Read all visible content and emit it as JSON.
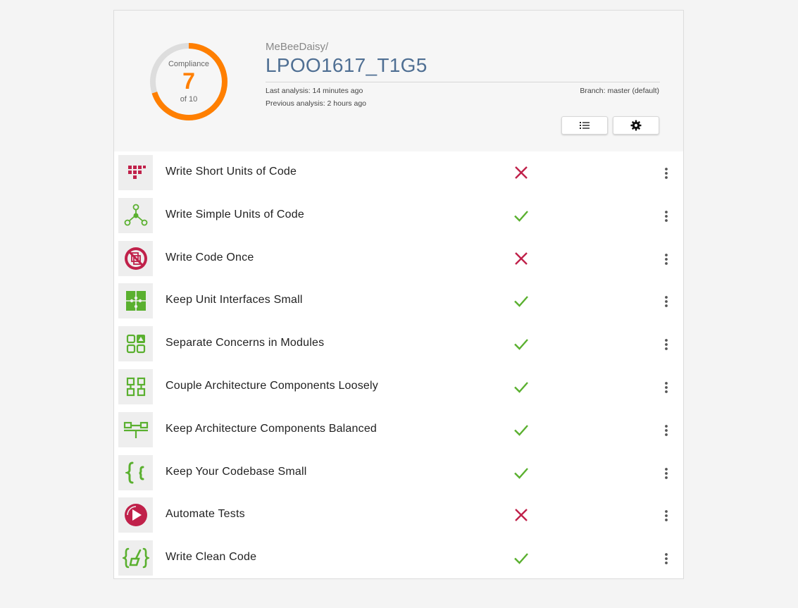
{
  "compliance": {
    "label": "Compliance",
    "score": "7",
    "of": "of 10",
    "fraction": 0.7,
    "ring_color": "#ff7f00",
    "track_color": "#dddddd"
  },
  "repo": {
    "owner": "MeBeeDaisy/",
    "name": "LPOO1617_T1G5",
    "last_analysis": "Last analysis: 14 minutes ago",
    "previous_analysis": "Previous analysis: 2 hours ago",
    "branch": "Branch: master (default)"
  },
  "toolbar": {
    "list_icon": "list-icon",
    "settings_icon": "gear-icon"
  },
  "colors": {
    "pass": "#5ab02f",
    "fail": "#c0214a",
    "title": "#4f6f93"
  },
  "guidelines": [
    {
      "title": "Write Short Units of Code",
      "status": "fail",
      "icon": "short-units-icon"
    },
    {
      "title": "Write Simple Units of Code",
      "status": "pass",
      "icon": "simple-units-icon"
    },
    {
      "title": "Write Code Once",
      "status": "fail",
      "icon": "code-once-icon"
    },
    {
      "title": "Keep Unit Interfaces Small",
      "status": "pass",
      "icon": "puzzle-icon"
    },
    {
      "title": "Separate Concerns in Modules",
      "status": "pass",
      "icon": "modules-icon"
    },
    {
      "title": "Couple Architecture Components Loosely",
      "status": "pass",
      "icon": "components-icon"
    },
    {
      "title": "Keep Architecture Components Balanced",
      "status": "pass",
      "icon": "balance-icon"
    },
    {
      "title": "Keep Your Codebase Small",
      "status": "pass",
      "icon": "braces-icon"
    },
    {
      "title": "Automate Tests",
      "status": "fail",
      "icon": "play-icon"
    },
    {
      "title": "Write Clean Code",
      "status": "pass",
      "icon": "broom-icon"
    }
  ]
}
